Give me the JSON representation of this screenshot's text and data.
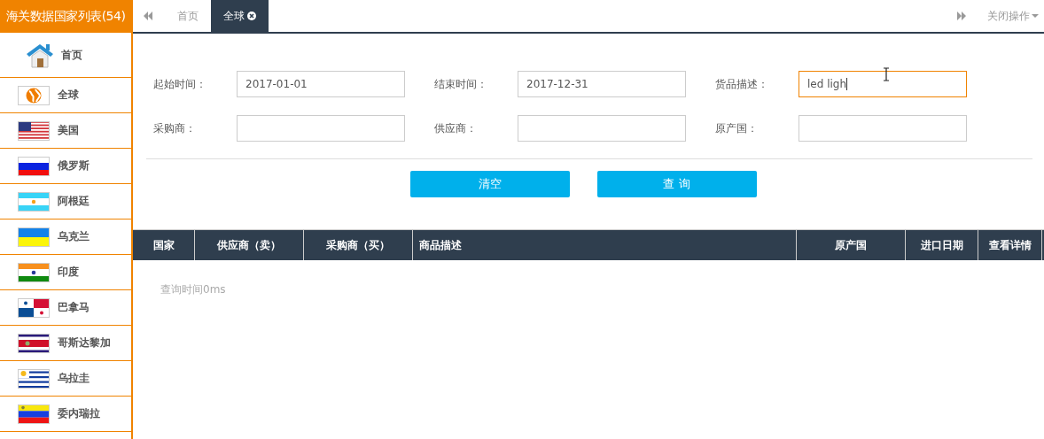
{
  "sidebar": {
    "title": "海关数据国家列表(54)",
    "items": [
      {
        "kind": "home",
        "label": "首页"
      },
      {
        "kind": "globe",
        "label": "全球"
      },
      {
        "kind": "flag",
        "label": "美国"
      },
      {
        "kind": "flag",
        "label": "俄罗斯"
      },
      {
        "kind": "flag",
        "label": "阿根廷"
      },
      {
        "kind": "flag",
        "label": "乌克兰"
      },
      {
        "kind": "flag",
        "label": "印度"
      },
      {
        "kind": "flag",
        "label": "巴拿马"
      },
      {
        "kind": "flag",
        "label": "哥斯达黎加"
      },
      {
        "kind": "flag",
        "label": "乌拉圭"
      },
      {
        "kind": "flag",
        "label": "委内瑞拉"
      }
    ]
  },
  "tabs": [
    {
      "label": "首页",
      "selected": false,
      "closable": false
    },
    {
      "label": "全球",
      "selected": true,
      "closable": true
    }
  ],
  "tab_actions": {
    "label": "关闭操作"
  },
  "form": {
    "fields": [
      {
        "label": "起始时间：",
        "value": "2017-01-01",
        "focused": false
      },
      {
        "label": "结束时间：",
        "value": "2017-12-31",
        "focused": false
      },
      {
        "label": "货品描述：",
        "value": "led ligh",
        "focused": true
      },
      {
        "label": "采购商：",
        "focused": false
      },
      {
        "label": "供应商：",
        "focused": false
      },
      {
        "label": "原产国：",
        "focused": false
      }
    ],
    "buttons": [
      "清空",
      "查 询"
    ]
  },
  "table": {
    "columns": [
      "国家",
      "供应商（卖）",
      "采购商（买）",
      "商品描述",
      "原产国",
      "进口日期",
      "查看详情"
    ],
    "message": "查询时间0ms"
  }
}
